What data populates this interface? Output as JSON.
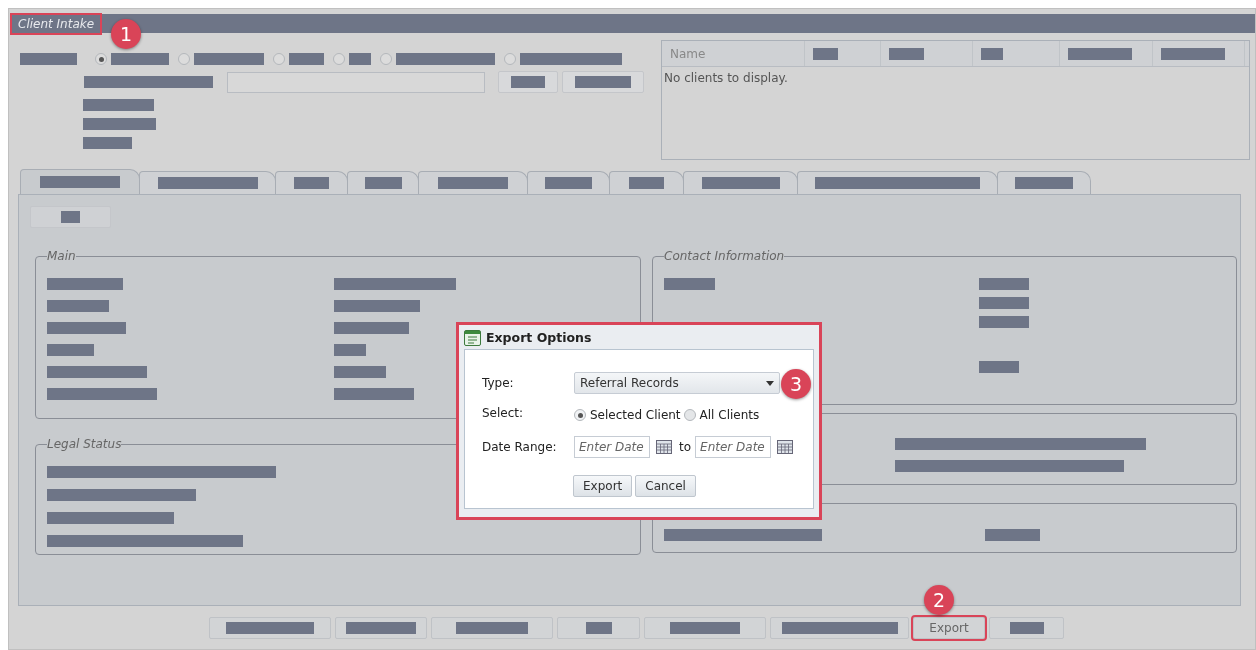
{
  "window": {
    "title": "Client Intake",
    "outlined": true
  },
  "search_radios": [
    {
      "selected": true
    },
    {
      "selected": false
    },
    {
      "selected": false
    },
    {
      "selected": false
    },
    {
      "selected": false
    },
    {
      "selected": false
    }
  ],
  "client_grid": {
    "columns": [
      "Name"
    ],
    "empty_message": "No clients to display."
  },
  "tabs": [
    {
      "selected": true
    },
    {
      "selected": false
    },
    {
      "selected": false
    },
    {
      "selected": false
    },
    {
      "selected": false
    },
    {
      "selected": false
    },
    {
      "selected": false
    },
    {
      "selected": false
    },
    {
      "selected": false
    },
    {
      "selected": false
    }
  ],
  "sections": [
    {
      "title": "Main"
    },
    {
      "title": "Contact Information"
    },
    {
      "title": "Legal Status"
    }
  ],
  "bottom_buttons": [
    {
      "kind": "redacted"
    },
    {
      "kind": "redacted"
    },
    {
      "kind": "redacted"
    },
    {
      "kind": "redacted"
    },
    {
      "kind": "redacted"
    },
    {
      "kind": "redacted"
    },
    {
      "kind": "text",
      "label": "Export",
      "outlined": true
    },
    {
      "kind": "redacted"
    }
  ],
  "dialog": {
    "title": "Export Options",
    "outlined": true,
    "type_label": "Type:",
    "type_value": "Referral Records",
    "select_label": "Select:",
    "options": [
      {
        "label": "Selected Client",
        "selected": true
      },
      {
        "label": "All Clients",
        "selected": false
      }
    ],
    "date_label": "Date Range:",
    "from_placeholder": "Enter Date",
    "to_text": "to",
    "to_placeholder": "Enter Date",
    "buttons": [
      "Export",
      "Cancel"
    ]
  },
  "callouts": [
    {
      "label": "1"
    },
    {
      "label": "2"
    },
    {
      "label": "3"
    }
  ]
}
